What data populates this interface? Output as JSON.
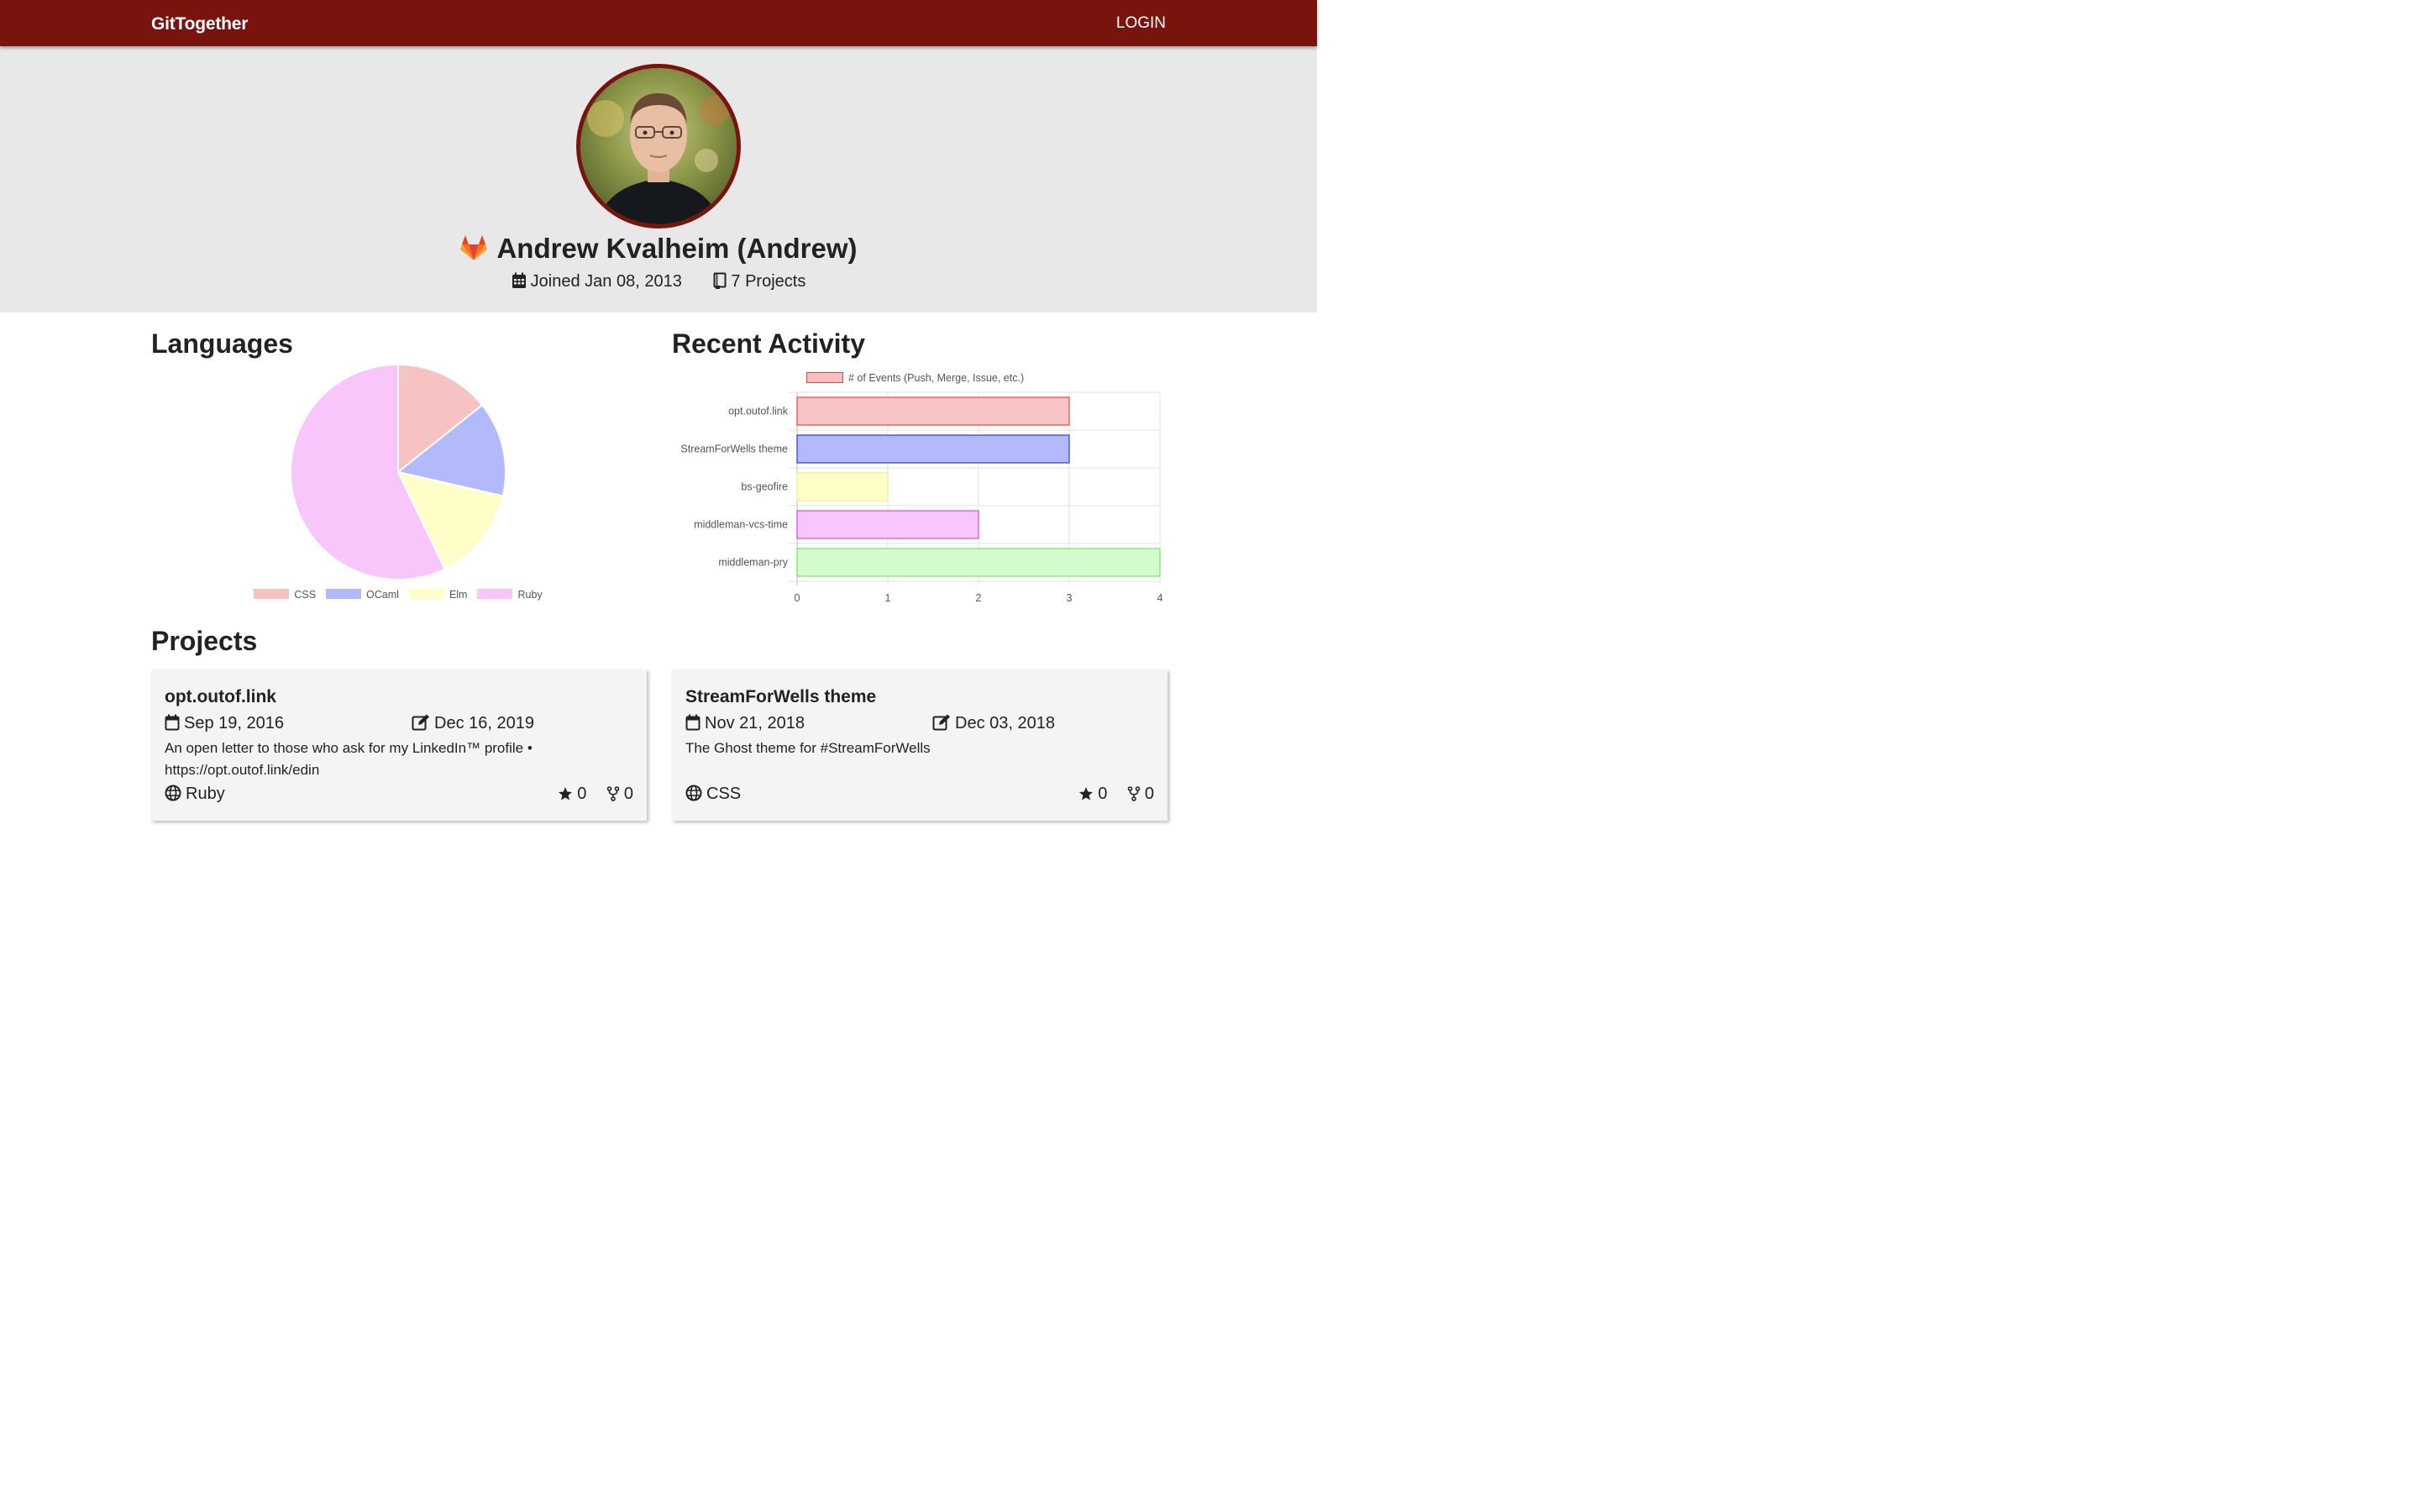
{
  "navbar": {
    "brand": "GitTogether",
    "login": "LOGIN"
  },
  "profile": {
    "name": "Andrew Kvalheim (Andrew)",
    "joined": "Joined Jan 08, 2013",
    "projects": "7 Projects"
  },
  "sections": {
    "languages": "Languages",
    "activity": "Recent Activity",
    "projects": "Projects"
  },
  "chart_data": [
    {
      "type": "pie",
      "categories": [
        "CSS",
        "OCaml",
        "Elm",
        "Ruby"
      ],
      "values": [
        1,
        1,
        1,
        4
      ],
      "colors": [
        "#f7c2c2",
        "#b3bafc",
        "#fffdc8",
        "#f8c6fb"
      ]
    },
    {
      "type": "bar",
      "orientation": "horizontal",
      "categories": [
        "opt.outof.link",
        "StreamForWells theme",
        "bs-geofire",
        "middleman-vcs-time",
        "middleman-pry"
      ],
      "series": [
        {
          "name": "# of Events (Push, Merge, Issue, etc.)",
          "values": [
            3,
            3,
            1,
            2,
            4
          ]
        }
      ],
      "fill_colors": [
        "#f8c4c4",
        "#b3bafc",
        "#fffdc8",
        "#f8c6fb",
        "#d2fccc"
      ],
      "border_colors": [
        "#e04848",
        "#2e38d8",
        "#eeee88",
        "#d44ae0",
        "#7ee06a"
      ],
      "xlim": [
        0,
        4
      ],
      "xticks": [
        "0",
        "1",
        "2",
        "3",
        "4"
      ],
      "grid": true,
      "legend": "top"
    }
  ],
  "projects": [
    {
      "title": "opt.outof.link",
      "created": "Sep 19, 2016",
      "updated": "Dec 16, 2019",
      "desc_line1": "An open letter to those who ask for my LinkedIn™ profile •",
      "desc_line2": "https://opt.outof.link/edin",
      "language": "Ruby",
      "stars": "0",
      "forks": "0"
    },
    {
      "title": "StreamForWells theme",
      "created": "Nov 21, 2018",
      "updated": "Dec 03, 2018",
      "desc_line1": "The Ghost theme for #StreamForWells",
      "desc_line2": "",
      "language": "CSS",
      "stars": "0",
      "forks": "0"
    }
  ],
  "icons": {
    "gitlab": "gitlab-icon",
    "calendar": "calendar-icon",
    "book": "book-icon",
    "edit": "edit-icon",
    "globe": "globe-icon",
    "star": "star-icon",
    "fork": "fork-icon"
  },
  "colors": {
    "navbar": "#78130d",
    "hero_bg": "#e8e8e8",
    "gitlab": "#e24329"
  }
}
